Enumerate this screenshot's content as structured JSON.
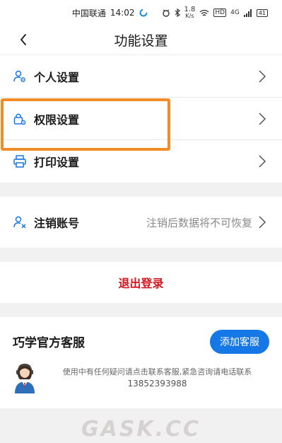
{
  "status_bar": {
    "carrier": "中国联通",
    "time": "14:02",
    "speed_value": "1.8",
    "speed_unit": "K/s",
    "hd": "HD",
    "network": "4G",
    "battery": "41"
  },
  "header": {
    "title": "功能设置",
    "back_icon": "chevron-left-icon"
  },
  "settings": [
    {
      "label": "个人设置",
      "icon": "person-gear-icon"
    },
    {
      "label": "权限设置",
      "icon": "lock-gear-icon"
    },
    {
      "label": "打印设置",
      "icon": "printer-icon"
    }
  ],
  "account": {
    "label": "注销账号",
    "hint": "注销后数据将不可恢复",
    "icon": "person-remove-icon"
  },
  "logout": {
    "label": "退出登录",
    "color": "#d4161e"
  },
  "customer_service": {
    "title": "巧学官方客服",
    "add_button": "添加客服",
    "description": "使用中有任何疑问请点击联系客服,紧急咨询请电话联系",
    "phone": "13852393988",
    "button_color": "#1677e6"
  },
  "highlight_color": "#f28c28",
  "watermark": "GASK.CC"
}
